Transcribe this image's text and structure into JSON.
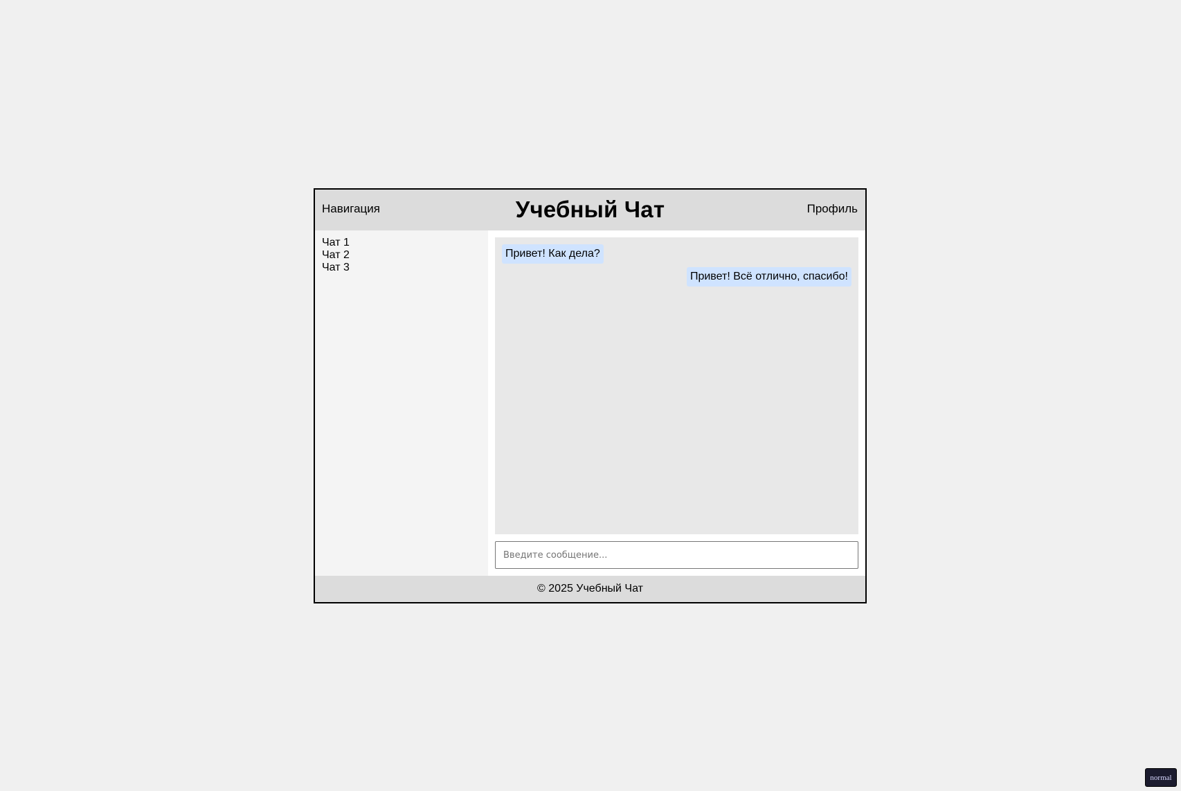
{
  "header": {
    "nav_label": "Навигация",
    "title": "Учебный Чат",
    "profile_label": "Профиль"
  },
  "sidebar": {
    "items": [
      {
        "label": "Чат 1"
      },
      {
        "label": "Чат 2"
      },
      {
        "label": "Чат 3"
      }
    ]
  },
  "messages": [
    {
      "text": "Привет! Как дела?",
      "direction": "incoming"
    },
    {
      "text": "Привет! Всё отлично, спасибо!",
      "direction": "outgoing"
    }
  ],
  "composer": {
    "placeholder": "Введите сообщение...",
    "value": ""
  },
  "footer": {
    "text": "© 2025 Учебный Чат"
  },
  "mode_badge": {
    "label": "normal"
  },
  "colors": {
    "page_background": "#f0f0f0",
    "header_footer_background": "#dcdcdc",
    "sidebar_background": "#f4f4f4",
    "messages_background": "#e8e8e8",
    "message_bubble": "#cfe3ff",
    "badge_background": "#1b1b2e"
  }
}
